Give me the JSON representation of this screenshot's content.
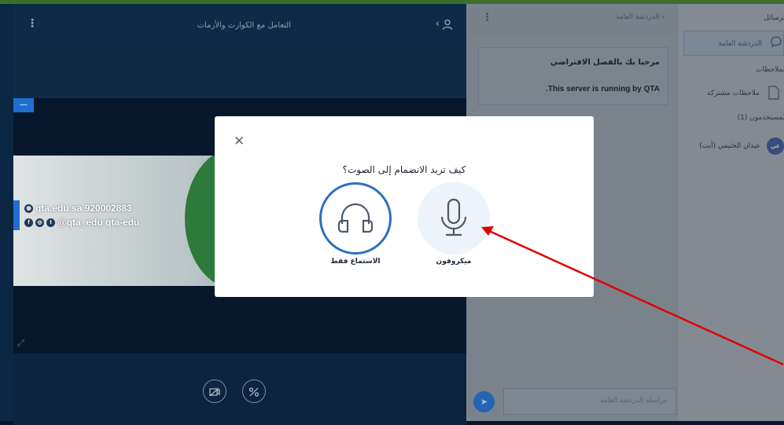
{
  "main": {
    "title": "التعامل مع الكوارث والأزمات",
    "presentation_tab": "—",
    "slide_line1": "qta.edu.sa  920002883",
    "slide_line2": "@qta_edu   qta-edu"
  },
  "chat": {
    "header_title": "الدردشة العامة",
    "welcome_line1": "مرحبا بك بالفصل الافتراضي",
    "welcome_line2": ".This server is running by QTA",
    "input_placeholder": "مراسلة الدردشة العامة"
  },
  "sidebar": {
    "messages_heading": "الرسائل",
    "public_chat": "الدردشة العامة",
    "notes_heading": "الملاحظات",
    "shared_notes": "ملاحظات مشتركة",
    "users_heading": "المستخدمون (1)",
    "user_name": "عيدان الخثيمي (أنت)",
    "user_avatar": "عي"
  },
  "modal": {
    "question": "كيف تريد الانضمام إلى الصوت؟",
    "listen_only": "الاستماع فقط",
    "microphone": "ميكروفون"
  },
  "colors": {
    "accent": "#2b6fc6",
    "annotation_arrow": "#e00000"
  }
}
